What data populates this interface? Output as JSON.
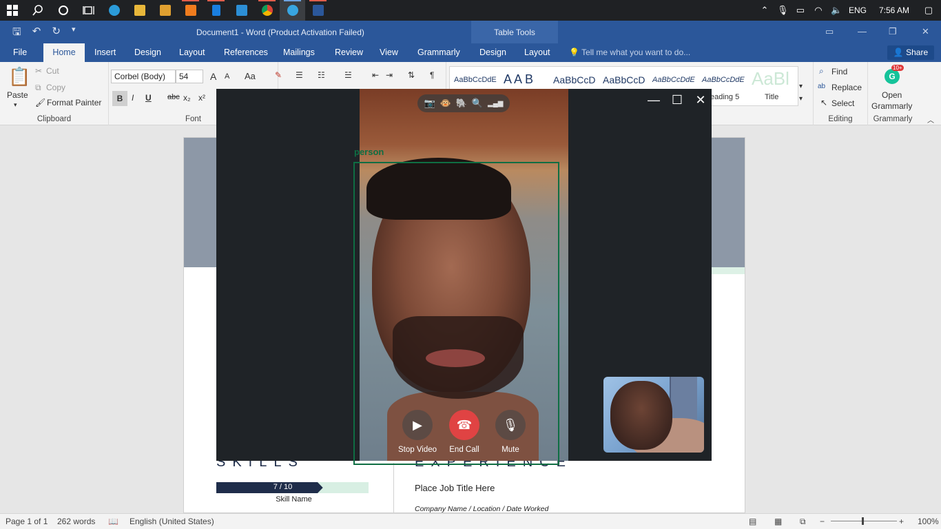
{
  "taskbar": {
    "apps": [
      {
        "name": "windows-start-icon",
        "glyph": "⊞"
      },
      {
        "name": "search-icon",
        "glyph": "⚲"
      },
      {
        "name": "cortana-icon",
        "glyph": "○"
      },
      {
        "name": "task-view-icon",
        "glyph": "⧉"
      },
      {
        "name": "edge-icon",
        "color": "#2b9bd9"
      },
      {
        "name": "file-explorer-icon",
        "color": "#e8b73a"
      },
      {
        "name": "store-icon",
        "color": "#e0a030"
      },
      {
        "name": "media-player-icon",
        "color": "#f07c1e"
      },
      {
        "name": "document-app-icon",
        "color": "#1a7fe0"
      },
      {
        "name": "vscode-icon",
        "color": "#2c8fd6"
      },
      {
        "name": "chrome-icon",
        "color": "#d9a233"
      },
      {
        "name": "telegram-icon",
        "color": "#38a5e0"
      },
      {
        "name": "word-icon",
        "color": "#2b579a"
      }
    ],
    "tray": {
      "language": "ENG",
      "time": "7:56 AM"
    }
  },
  "word": {
    "title": "Document1 - Word (Product Activation Failed)",
    "table_tools": "Table Tools",
    "tabs": [
      "File",
      "Home",
      "Insert",
      "Design",
      "Layout",
      "References",
      "Mailings",
      "Review",
      "View",
      "Grammarly",
      "Design",
      "Layout"
    ],
    "active_tab": "Home",
    "tell_me": "Tell me what you want to do...",
    "share": "Share",
    "ribbon": {
      "clipboard": {
        "paste": "Paste",
        "cut": "Cut",
        "copy": "Copy",
        "format_painter": "Format Painter",
        "label": "Clipboard"
      },
      "font": {
        "family": "Corbel (Body)",
        "size": "54",
        "label": "Font",
        "grow": "A",
        "change_case": "Aa",
        "bold": "B",
        "italic": "I",
        "underline": "U",
        "strike": "abc",
        "sub": "x₂",
        "sup": "x²"
      },
      "styles": [
        "AaBbCcDdE",
        "A A B",
        "AaBbCcD",
        "AaBbCcD",
        "AaBbCcDdE",
        "AaBbCcDdE",
        "AaBl"
      ],
      "style_names": [
        "eading 5",
        "Title"
      ],
      "editing": {
        "find": "Find",
        "replace": "Replace",
        "select": "Select",
        "label": "Editing"
      },
      "grammarly": {
        "badge": "10+",
        "open": "Open",
        "grammarly": "Grammarly",
        "label": "Grammarly"
      }
    }
  },
  "document": {
    "skills_heading": "SKILLS",
    "experience_heading": "EXPERIENCE",
    "skill_value": "7 / 10",
    "skill_level": 0.7,
    "skill_name": "Skill Name",
    "job_title": "Place Job Title Here",
    "company": "Company Name / Location / Date Worked"
  },
  "statusbar": {
    "page": "Page 1 of 1",
    "words": "262 words",
    "language": "English (United States)",
    "zoom": "100%"
  },
  "call": {
    "detection_label": "person",
    "stop_video": "Stop Video",
    "end_call": "End Call",
    "mute": "Mute"
  }
}
